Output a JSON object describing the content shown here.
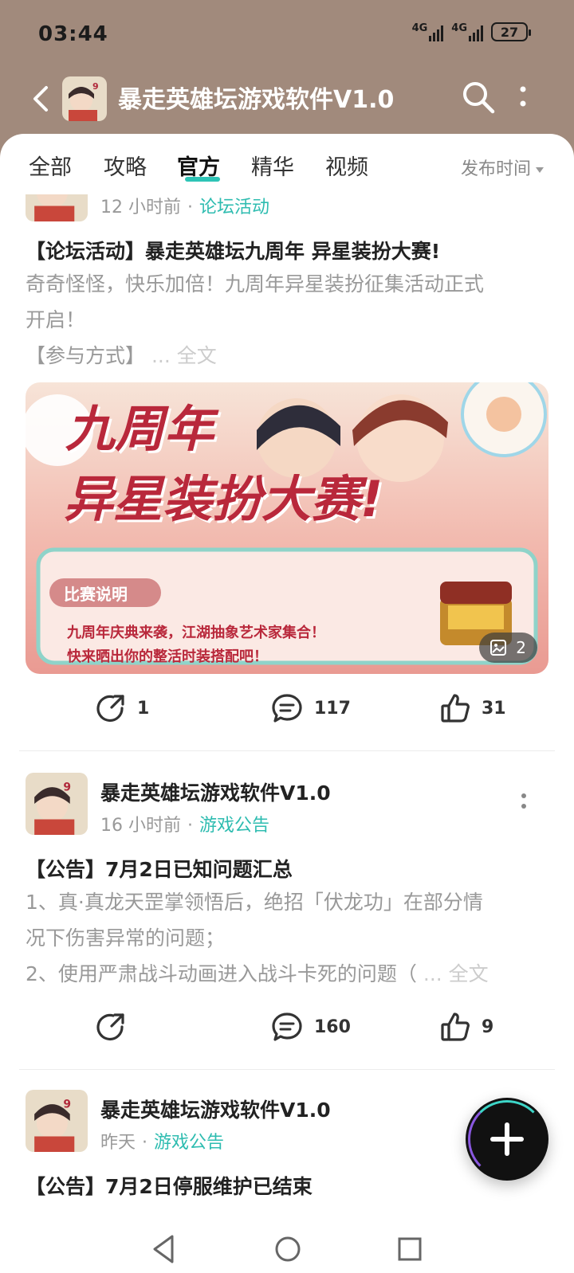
{
  "status": {
    "time": "03:44",
    "network1": "4G",
    "network2": "4G",
    "battery": "27"
  },
  "topbar": {
    "title": "暴走英雄坛游戏软件V1.0"
  },
  "tabs": [
    {
      "label": "全部"
    },
    {
      "label": "攻略"
    },
    {
      "label": "官方",
      "active": true
    },
    {
      "label": "精华"
    },
    {
      "label": "视频"
    }
  ],
  "sort": {
    "label": "发布时间"
  },
  "posts": [
    {
      "time": "12 小时前",
      "category": "论坛活动",
      "title": "【论坛活动】暴走英雄坛九周年 异星装扮大赛!",
      "body_line1": "奇奇怪怪，快乐加倍！九周年异星装扮征集活动正式",
      "body_line2": "开启！",
      "body_line3": "【参与方式】",
      "ellipsis": "... ",
      "full": "全文",
      "banner": {
        "headline1": "九周年",
        "headline2": "异星装扮大赛!",
        "tag": "比赛说明",
        "desc1": "九周年庆典来袭，江湖抽象艺术家集合！",
        "desc2": "快来晒出你的整活时装搭配吧！",
        "image_count": "2"
      },
      "shares": "1",
      "comments": "117",
      "likes": "31"
    },
    {
      "author": "暴走英雄坛游戏软件V1.0",
      "time": "16 小时前",
      "category": "游戏公告",
      "title": "【公告】7月2日已知问题汇总",
      "body_line1": "1、真·真龙天罡掌领悟后，绝招「伏龙功」在部分情",
      "body_line2": "况下伤害异常的问题；",
      "body_line3": "2、使用严肃战斗动画进入战斗卡死的问题（",
      "ellipsis": "... ",
      "full": "全文",
      "comments": "160",
      "likes": "9"
    },
    {
      "author": "暴走英雄坛游戏软件V1.0",
      "time": "昨天",
      "category": "游戏公告",
      "title": "【公告】7月2日停服维护已结束"
    }
  ],
  "colors": {
    "header_bg": "#a18a7c",
    "accent": "#2ebcb0",
    "text_muted": "#999999"
  }
}
